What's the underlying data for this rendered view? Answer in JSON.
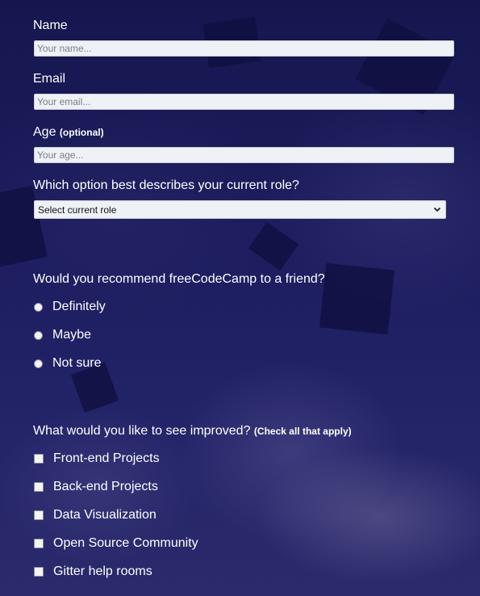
{
  "form": {
    "name": {
      "label": "Name",
      "placeholder": "Your name..."
    },
    "email": {
      "label": "Email",
      "placeholder": "Your email..."
    },
    "age": {
      "label": "Age",
      "note": "(optional)",
      "placeholder": "Your age..."
    },
    "role": {
      "question": "Which option best describes your current role?",
      "selected": "Select current role"
    },
    "recommend": {
      "question": "Would you recommend freeCodeCamp to a friend?",
      "options": [
        "Definitely",
        "Maybe",
        "Not sure"
      ]
    },
    "improve": {
      "question": "What would you like to see improved?",
      "note": "(Check all that apply)",
      "options": [
        "Front-end Projects",
        "Back-end Projects",
        "Data Visualization",
        "Open Source Community",
        "Gitter help rooms"
      ]
    }
  },
  "colors": {
    "background": "#1b1b5a",
    "input_bg": "#eef1f6",
    "text": "#ffffff"
  }
}
